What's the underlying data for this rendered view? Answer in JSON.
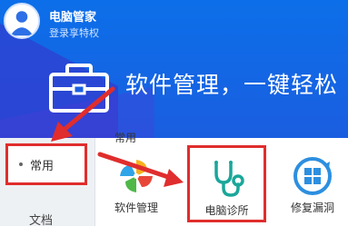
{
  "user": {
    "name": "电脑管家",
    "login_prompt": "登录享特权"
  },
  "hero": {
    "title": "软件管理，一键轻松"
  },
  "sidebar": {
    "items": [
      {
        "label": "常用",
        "active": true
      },
      {
        "label": "文档",
        "active": false
      }
    ]
  },
  "section": {
    "label": "常用"
  },
  "apps": [
    {
      "label": "软件管理",
      "icon": "pinwheel-icon"
    },
    {
      "label": "电脑诊所",
      "icon": "stethoscope-icon"
    },
    {
      "label": "修复漏洞",
      "icon": "windows-shield-icon"
    }
  ],
  "colors": {
    "header_blue": "#0c6fe9",
    "highlight_red": "#e02d2d",
    "sidebar_bg": "#eef1f4"
  }
}
